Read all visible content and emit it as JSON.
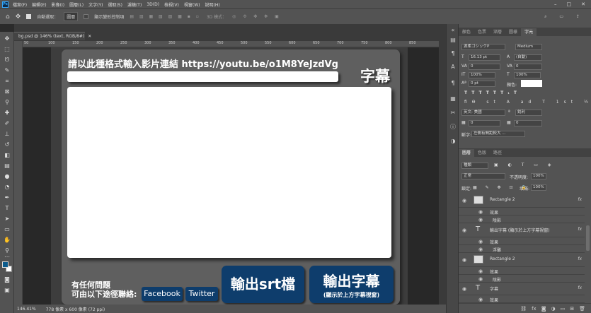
{
  "menubar": {
    "app_icon": "Ps",
    "items": [
      "檔案(F)",
      "編輯(E)",
      "影像(I)",
      "圖層(L)",
      "文字(Y)",
      "選取(S)",
      "濾鏡(T)",
      "3D(D)",
      "檢視(V)",
      "視窗(W)",
      "說明(H)"
    ]
  },
  "options": {
    "auto_select_label": "自動選取：",
    "auto_select_value": "圖層",
    "show_transform_label": "顯示變形控制項",
    "mode_3d_label": "3D 模式："
  },
  "document": {
    "tab_title": "bg.psd @ 146% (text, RGB/8#)",
    "zoom": "146.41%",
    "size_info": "778 像素 x 600 像素 (72 ppi)",
    "ruler_ticks": [
      "50",
      "100",
      "150",
      "200",
      "250",
      "300",
      "350",
      "400",
      "450",
      "500",
      "550",
      "600",
      "650",
      "700",
      "750",
      "800",
      "850"
    ]
  },
  "artboard": {
    "url_label": "請以此種格式輸入影片連結 https://youtu.be/o1M8YeJzdVg",
    "subtitle_title": "字幕",
    "contact_line1": "有任何問題",
    "contact_line2": "可由以下途徑聯絡:",
    "facebook": "Facebook",
    "twitter": "Twitter",
    "srt_button": "輸出srt檔",
    "out_button_title": "輸出字幕",
    "out_button_sub": "(顯示於上方字幕視窗)"
  },
  "character_panel": {
    "tabs": [
      "顏色",
      "色票",
      "漸層",
      "圖樣",
      "字元"
    ],
    "font_family": "源柔ゴシックP",
    "font_style": "Medium",
    "font_size": "16.13 pt",
    "leading": "(自動)",
    "kerning": "0",
    "tracking": "0",
    "vscale": "100%",
    "hscale": "100%",
    "baseline": "0 pt",
    "color_label": "顏色:",
    "language": "英文: 美國",
    "antialias": "銳利",
    "hyphen_label": "斷字:",
    "hyphen_value": "左側有間距較大 ..."
  },
  "layers_panel": {
    "tabs": [
      "圖層",
      "色版",
      "路徑"
    ],
    "filter": "種類",
    "blend_mode": "正常",
    "opacity_label": "不透明度:",
    "opacity": "100%",
    "lock_label": "鎖定:",
    "fill_label": "填滿:",
    "fill": "100%",
    "layers": [
      {
        "name": "Rectangle 2",
        "type": "shape"
      },
      {
        "name": "效果",
        "type": "effect"
      },
      {
        "name": "陰影",
        "type": "effect-item"
      },
      {
        "name": "輸出字幕 (顯示於上方字幕視窗)",
        "type": "text"
      },
      {
        "name": "效果",
        "type": "effect"
      },
      {
        "name": "浮雕",
        "type": "effect-item"
      },
      {
        "name": "Rectangle 2",
        "type": "shape"
      },
      {
        "name": "效果",
        "type": "effect"
      },
      {
        "name": "陰影",
        "type": "effect-item"
      },
      {
        "name": "字幕",
        "type": "text"
      },
      {
        "name": "效果",
        "type": "effect"
      }
    ]
  },
  "colors": {
    "fb_button": "#0e3d6c",
    "panel": "#5f5f5f",
    "ps_accent": "#31a8ff"
  }
}
